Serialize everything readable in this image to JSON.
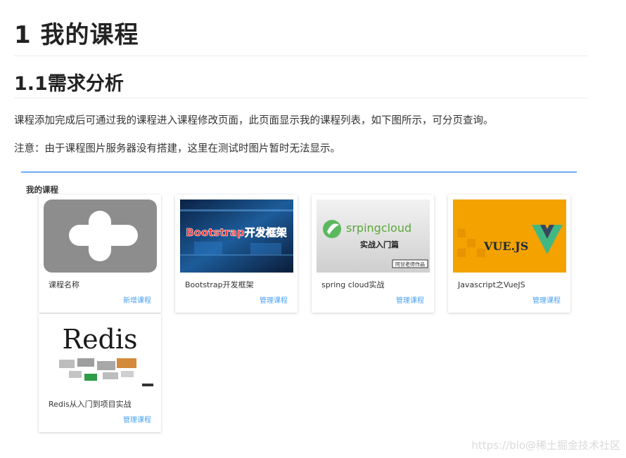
{
  "heading1": "1 我的课程",
  "heading2": "1.1需求分析",
  "paragraphs": [
    "课程添加完成后可通过我的课程进入课程修改页面，此页面显示我的课程列表，如下图所示，可分页查询。",
    "注意：由于课程图片服务器没有搭建，这里在测试时图片暂时无法显示。"
  ],
  "screenshot": {
    "title": "我的课程",
    "accent_color": "#6aaef5",
    "link_color": "#4aa2f0",
    "courses": [
      {
        "name": "课程名称",
        "action": "新增课程",
        "thumb": "add-placeholder"
      },
      {
        "name": "Bootstrap开发框架",
        "action": "管理课程",
        "thumb": "bootstrap-cover",
        "thumb_text": "Bootstrap开发框架"
      },
      {
        "name": "spring cloud实战",
        "action": "管理课程",
        "thumb": "springcloud-cover",
        "thumb_text": "srpingcloud",
        "thumb_sub": "实战入门篇",
        "thumb_stamp": "阿甘老师作品"
      },
      {
        "name": "Javascript之VueJS",
        "action": "管理课程",
        "thumb": "vue-cover",
        "thumb_text": "VUE.JS"
      },
      {
        "name": "Redis从入门到项目实战",
        "action": "管理课程",
        "thumb": "redis-cover",
        "thumb_text": "Redis"
      }
    ]
  },
  "watermark": "https://blo@稀土掘金技术社区"
}
